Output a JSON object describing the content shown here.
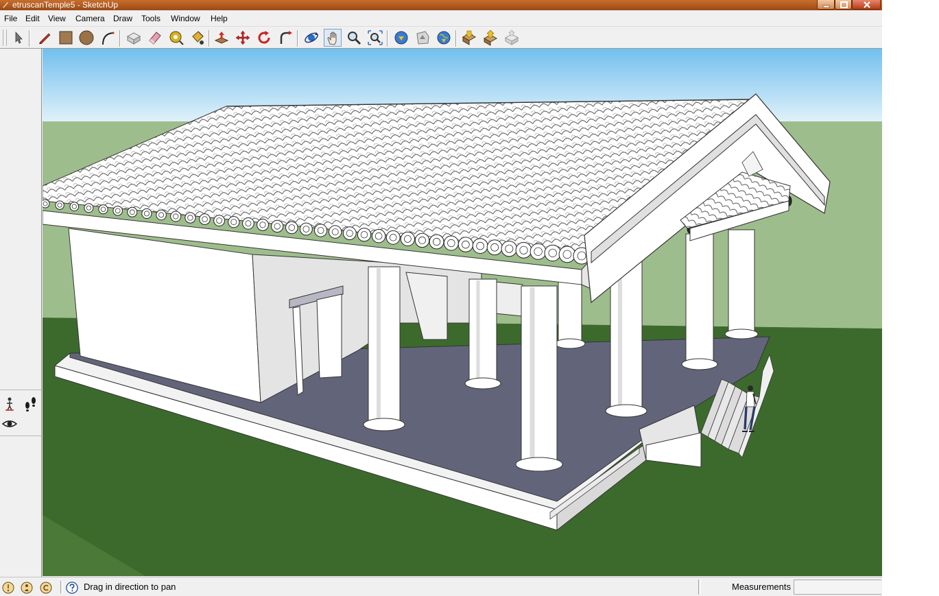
{
  "window": {
    "title": "etruscanTemple5 - SketchUp",
    "controls": [
      "minimize-icon",
      "maximize-icon",
      "close-icon"
    ]
  },
  "menu": {
    "items": [
      "File",
      "Edit",
      "View",
      "Camera",
      "Draw",
      "Tools",
      "Window",
      "Help"
    ]
  },
  "toolbar": {
    "tools": [
      {
        "name": "select",
        "icon": "arrow-cursor-icon"
      },
      {
        "name": "line",
        "icon": "pencil-icon"
      },
      {
        "name": "rectangle",
        "icon": "rectangle-icon"
      },
      {
        "name": "circle",
        "icon": "circle-icon"
      },
      {
        "name": "arc",
        "icon": "arc-icon"
      },
      {
        "name": "make-component",
        "icon": "component-icon"
      },
      {
        "name": "eraser",
        "icon": "eraser-icon"
      },
      {
        "name": "tape-measure",
        "icon": "tape-measure-icon"
      },
      {
        "name": "paint-bucket",
        "icon": "paint-bucket-icon"
      },
      {
        "name": "push-pull",
        "icon": "push-pull-icon"
      },
      {
        "name": "move",
        "icon": "move-icon"
      },
      {
        "name": "rotate",
        "icon": "rotate-icon"
      },
      {
        "name": "follow-me",
        "icon": "follow-me-icon"
      },
      {
        "name": "orbit",
        "icon": "orbit-icon"
      },
      {
        "name": "pan",
        "icon": "hand-icon",
        "active": true
      },
      {
        "name": "zoom",
        "icon": "magnifier-icon"
      },
      {
        "name": "zoom-extents",
        "icon": "zoom-extents-icon"
      },
      {
        "name": "previous-view",
        "icon": "previous-view-icon"
      },
      {
        "name": "next-view",
        "icon": "next-view-icon"
      },
      {
        "name": "add-location",
        "icon": "globe-icon"
      },
      {
        "name": "get-models",
        "icon": "get-models-icon"
      },
      {
        "name": "share-model",
        "icon": "share-model-icon"
      },
      {
        "name": "share-component",
        "icon": "share-component-icon"
      }
    ]
  },
  "left_palette": {
    "tools": [
      {
        "name": "position-camera",
        "icon": "position-camera-icon"
      },
      {
        "name": "walk",
        "icon": "footprints-icon"
      },
      {
        "name": "look-around",
        "icon": "eye-icon"
      }
    ]
  },
  "status": {
    "icons": [
      "geo-location-icon",
      "credits-icon",
      "copyright-icon"
    ],
    "help_icon": "question-icon",
    "message": "Drag in direction to pan",
    "measurements_label": "Measurements",
    "measurements_value": ""
  },
  "colors": {
    "title_bar": "#b05c20",
    "sky": "#8ccbed",
    "ground": "#3c6a2c",
    "ground_far": "#9ebd8c",
    "temple_floor": "#62657a",
    "temple_white": "#ffffff"
  }
}
